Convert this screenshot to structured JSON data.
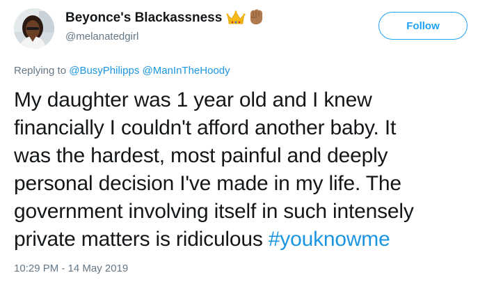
{
  "author": {
    "display_name": "Beyonce's Blackassness",
    "username": "@melanatedgirl",
    "badges": [
      "crown-emoji",
      "fist-emoji"
    ]
  },
  "follow_button": {
    "label": "Follow"
  },
  "reply": {
    "prefix": "Replying to",
    "mentions": [
      "@BusyPhilipps",
      "@ManInTheHoody"
    ]
  },
  "tweet": {
    "lines": [
      "My daughter was 1 year old and I knew",
      "financially I couldn't afford another baby. It",
      "was the hardest, most painful and deeply",
      "personal decision I've made in my life. The",
      "government involving itself in such intensely",
      "private matters is ridiculous"
    ],
    "hashtag": "#youknowme",
    "timestamp": "10:29 PM - 14 May 2019"
  },
  "colors": {
    "accent": "#1da1f2",
    "link": "#1b95e0",
    "secondary_text": "#657786",
    "primary_text": "#14171a"
  }
}
